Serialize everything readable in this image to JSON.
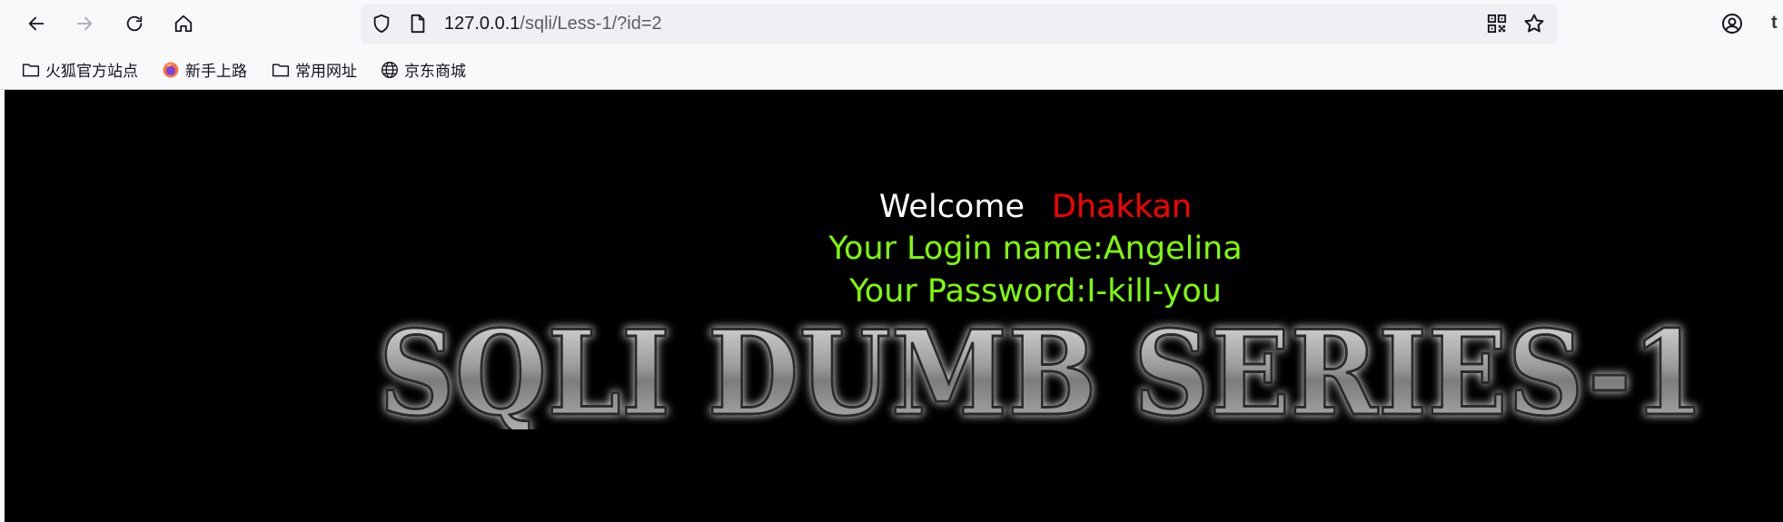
{
  "browser": {
    "url_host": "127.0.0.1",
    "url_path": "/sqli/Less-1/?id=2",
    "bookmarks": [
      {
        "label": "火狐官方站点",
        "icon": "folder-icon"
      },
      {
        "label": "新手上路",
        "icon": "firefox-icon"
      },
      {
        "label": "常用网址",
        "icon": "folder-icon"
      },
      {
        "label": "京东商城",
        "icon": "globe-icon"
      }
    ]
  },
  "page": {
    "welcome_label": "Welcome",
    "welcome_name": "Dhakkan",
    "login_line": "Your Login name:Angelina",
    "password_line": "Your Password:I-kill-you",
    "banner_text": "SQLI DUMB SERIES-1"
  },
  "colors": {
    "background": "#000000",
    "welcome_name": "#ff0000",
    "result_text": "#7fff00"
  }
}
